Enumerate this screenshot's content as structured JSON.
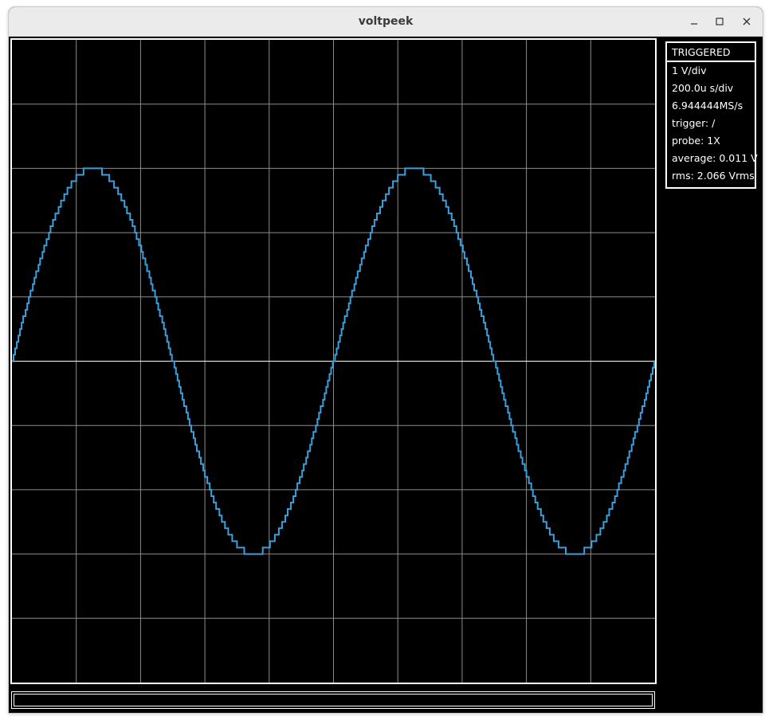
{
  "window": {
    "title": "voltpeek"
  },
  "status": {
    "trigger_state": "TRIGGERED",
    "rows": [
      "1 V/div",
      "200.0u s/div",
      "6.944444MS/s",
      "trigger: /",
      "probe: 1X",
      "average: 0.011 V",
      "rms: 2.066 Vrms"
    ]
  },
  "colors": {
    "background": "#000000",
    "grid": "#8c8c8c",
    "center_line": "#ffffff",
    "trace": "#3aa0dc",
    "text": "#ffffff"
  },
  "chart_data": {
    "type": "line",
    "grid_divisions_x": 10,
    "grid_divisions_y": 10,
    "grid": true,
    "xlim_div": [
      0,
      10
    ],
    "ylim_v": [
      -5,
      5
    ],
    "volts_per_div": 1,
    "seconds_per_div": "200.0u",
    "series": [
      {
        "waveform": "sine",
        "amplitude_v": 3.0,
        "offset_v": 0.0,
        "cycles_on_screen": 2.0,
        "phase_start_deg": 0,
        "quantization_steps_per_div": 10
      }
    ]
  }
}
